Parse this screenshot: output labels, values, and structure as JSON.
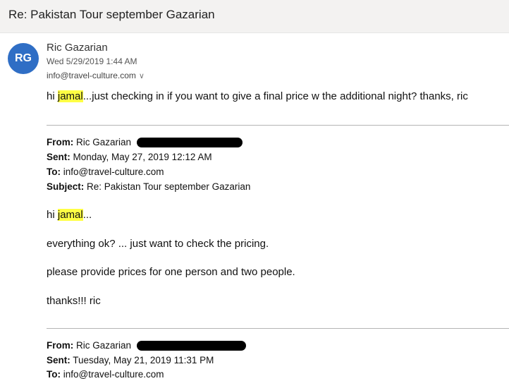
{
  "subject": "Re: Pakistan Tour september Gazarian",
  "message": {
    "avatar_initials": "RG",
    "sender": "Ric Gazarian",
    "date": "Wed 5/29/2019 1:44 AM",
    "to": "info@travel-culture.com",
    "greeting": "hi",
    "highlight": "jamal",
    "body_rest": "...just checking in if you want to give a final price w the additional night?  thanks, ric"
  },
  "quoted1": {
    "from_label": "From:",
    "from_value": "Ric Gazarian",
    "sent_label": "Sent:",
    "sent_value": "Monday, May 27, 2019 12:12 AM",
    "to_label": "To:",
    "to_value": "info@travel-culture.com",
    "subject_label": "Subject:",
    "subject_value": "Re: Pakistan Tour september Gazarian",
    "greeting": "hi",
    "highlight": "jamal",
    "greeting_rest": "...",
    "line2": "everything ok?  ... just want to check the pricing.",
    "line3": "please provide prices for one person and two people.",
    "line4": "thanks!!! ric"
  },
  "quoted2": {
    "from_label": "From:",
    "from_value": "Ric Gazarian",
    "sent_label": "Sent:",
    "sent_value": "Tuesday, May 21, 2019 11:31 PM",
    "to_label": "To:",
    "to_value": "info@travel-culture.com"
  }
}
